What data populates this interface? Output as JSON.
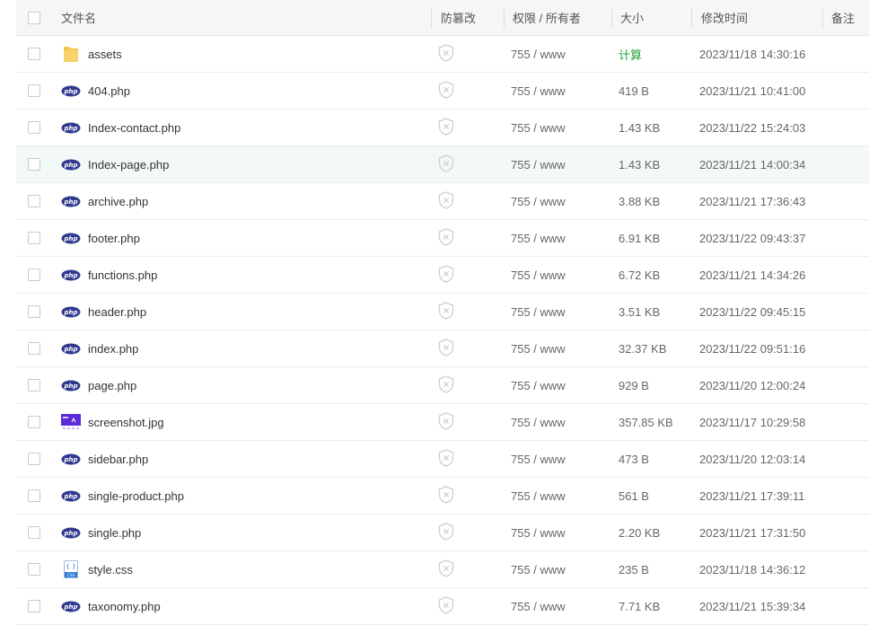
{
  "header": {
    "name": "文件名",
    "protect": "防篡改",
    "perm": "权限 / 所有者",
    "size": "大小",
    "mtime": "修改时间",
    "note": "备注"
  },
  "rows": [
    {
      "name": "assets",
      "icon": "folder-icon",
      "perm": "755 / www",
      "size": "计算",
      "mtime": "2023/11/18 14:30:16"
    },
    {
      "name": "404.php",
      "icon": "php-file-icon",
      "perm": "755 / www",
      "size": "419 B",
      "mtime": "2023/11/21 10:41:00"
    },
    {
      "name": "Index-contact.php",
      "icon": "php-file-icon",
      "perm": "755 / www",
      "size": "1.43 KB",
      "mtime": "2023/11/22 15:24:03"
    },
    {
      "name": "Index-page.php",
      "icon": "php-file-icon",
      "perm": "755 / www",
      "size": "1.43 KB",
      "mtime": "2023/11/21 14:00:34"
    },
    {
      "name": "archive.php",
      "icon": "php-file-icon",
      "perm": "755 / www",
      "size": "3.88 KB",
      "mtime": "2023/11/21 17:36:43"
    },
    {
      "name": "footer.php",
      "icon": "php-file-icon",
      "perm": "755 / www",
      "size": "6.91 KB",
      "mtime": "2023/11/22 09:43:37"
    },
    {
      "name": "functions.php",
      "icon": "php-file-icon",
      "perm": "755 / www",
      "size": "6.72 KB",
      "mtime": "2023/11/21 14:34:26"
    },
    {
      "name": "header.php",
      "icon": "php-file-icon",
      "perm": "755 / www",
      "size": "3.51 KB",
      "mtime": "2023/11/22 09:45:15"
    },
    {
      "name": "index.php",
      "icon": "php-file-icon",
      "perm": "755 / www",
      "size": "32.37 KB",
      "mtime": "2023/11/22 09:51:16"
    },
    {
      "name": "page.php",
      "icon": "php-file-icon",
      "perm": "755 / www",
      "size": "929 B",
      "mtime": "2023/11/20 12:00:24"
    },
    {
      "name": "screenshot.jpg",
      "icon": "image-file-icon",
      "perm": "755 / www",
      "size": "357.85 KB",
      "mtime": "2023/11/17 10:29:58"
    },
    {
      "name": "sidebar.php",
      "icon": "php-file-icon",
      "perm": "755 / www",
      "size": "473 B",
      "mtime": "2023/11/20 12:03:14"
    },
    {
      "name": "single-product.php",
      "icon": "php-file-icon",
      "perm": "755 / www",
      "size": "561 B",
      "mtime": "2023/11/21 17:39:11"
    },
    {
      "name": "single.php",
      "icon": "php-file-icon",
      "perm": "755 / www",
      "size": "2.20 KB",
      "mtime": "2023/11/21 17:31:50"
    },
    {
      "name": "style.css",
      "icon": "css-file-icon",
      "perm": "755 / www",
      "size": "235 B",
      "mtime": "2023/11/18 14:36:12"
    },
    {
      "name": "taxonomy.php",
      "icon": "php-file-icon",
      "perm": "755 / www",
      "size": "7.71 KB",
      "mtime": "2023/11/21 15:39:34"
    }
  ],
  "highlight_row": 3,
  "colors": {
    "accent_green": "#20a53a",
    "php_badge": "#2f3a8f",
    "folder": "#f4c34a"
  }
}
